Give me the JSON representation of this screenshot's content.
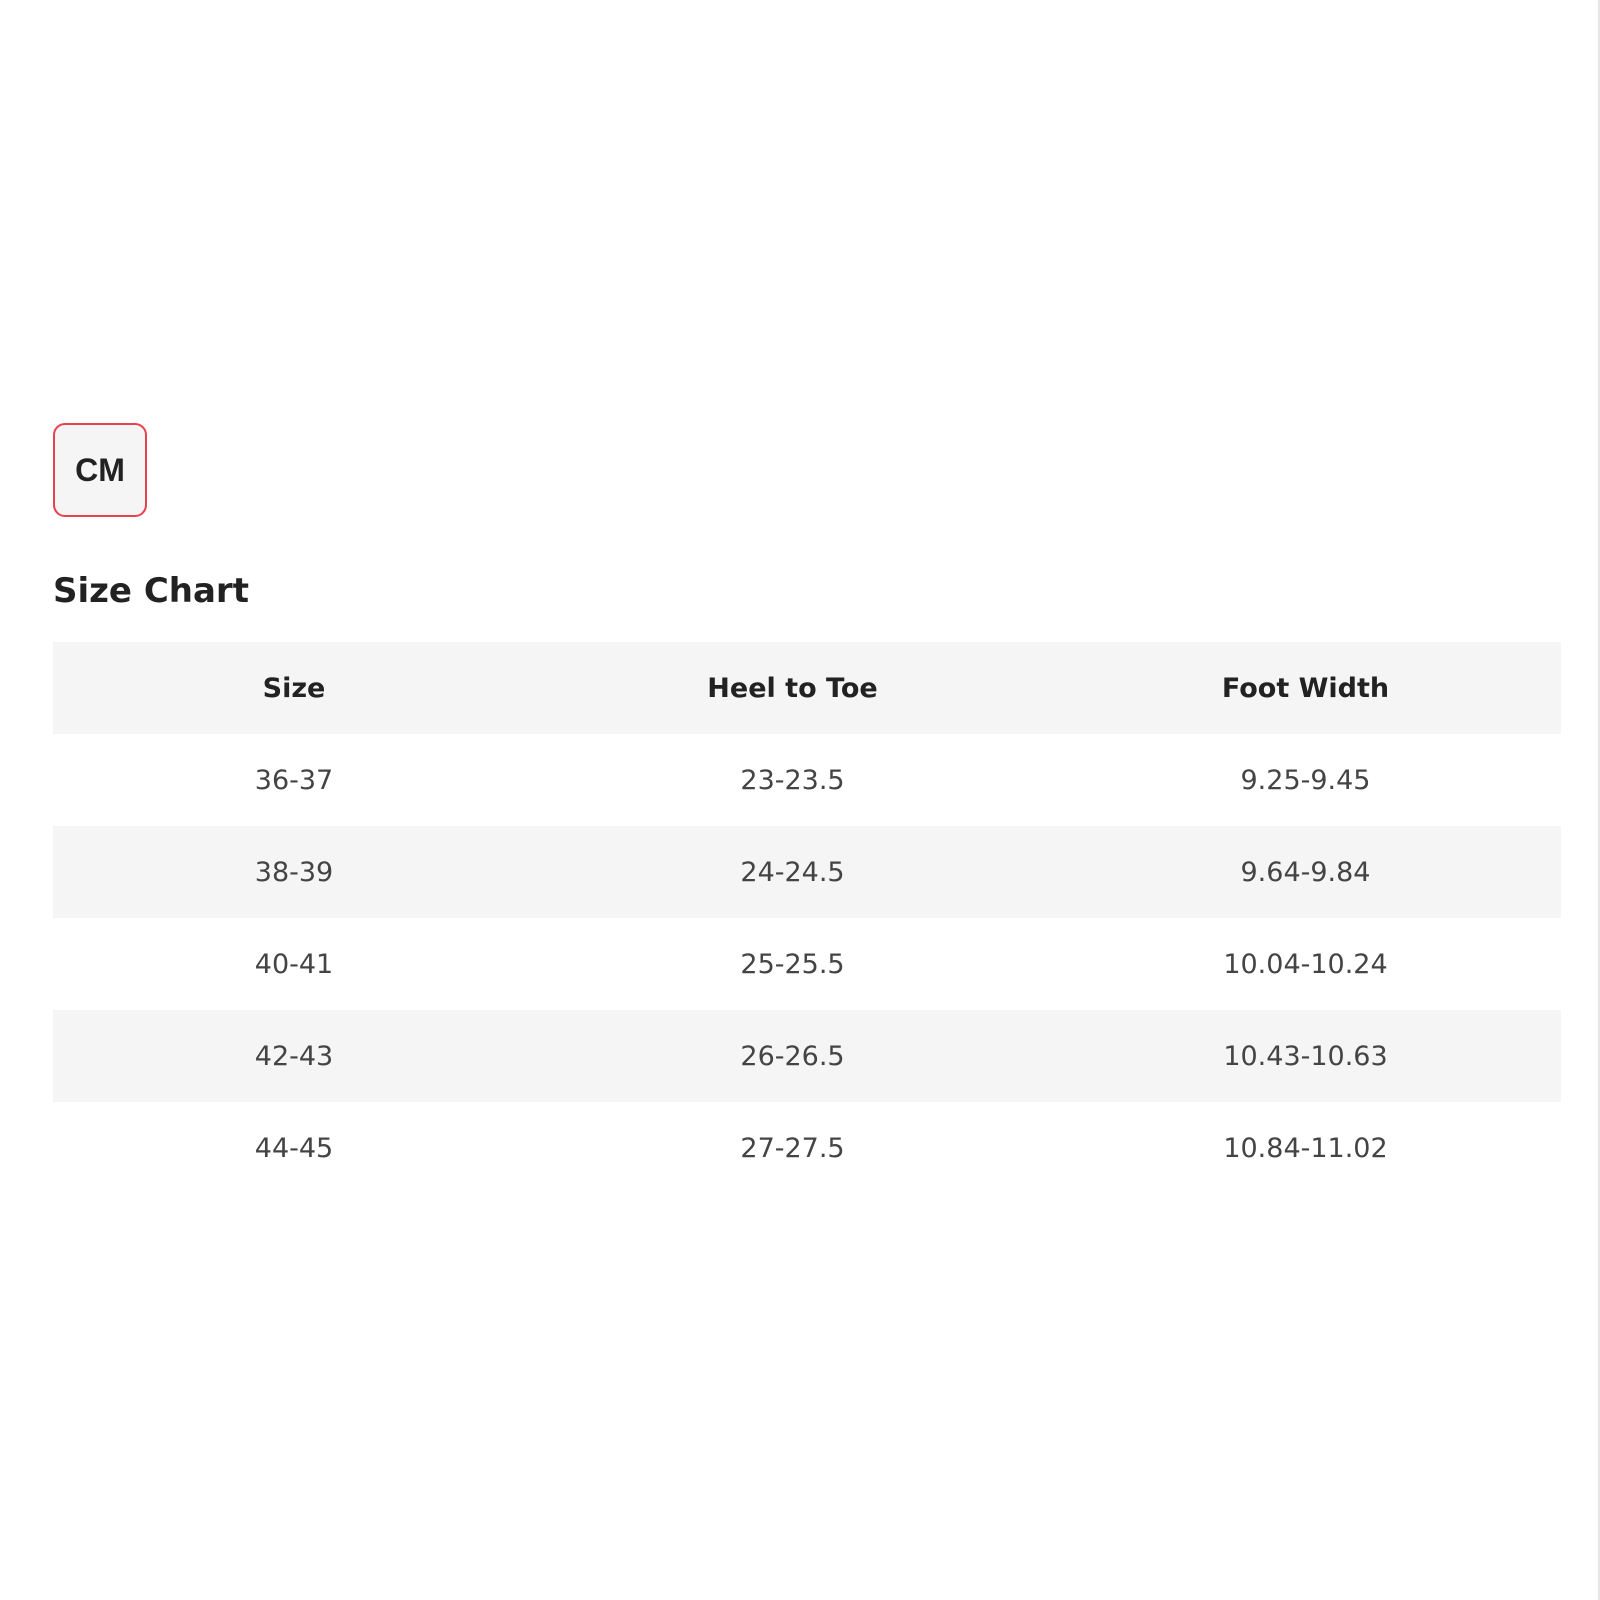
{
  "unit_toggle": {
    "label": "CM",
    "accent_color": "#e8424f"
  },
  "size_chart": {
    "title": "Size Chart",
    "columns": [
      "Size",
      "Heel to Toe",
      "Foot Width"
    ],
    "rows": [
      [
        "36-37",
        "23-23.5",
        "9.25-9.45"
      ],
      [
        "38-39",
        "24-24.5",
        "9.64-9.84"
      ],
      [
        "40-41",
        "25-25.5",
        "10.04-10.24"
      ],
      [
        "42-43",
        "26-26.5",
        "10.43-10.63"
      ],
      [
        "44-45",
        "27-27.5",
        "10.84-11.02"
      ]
    ]
  }
}
